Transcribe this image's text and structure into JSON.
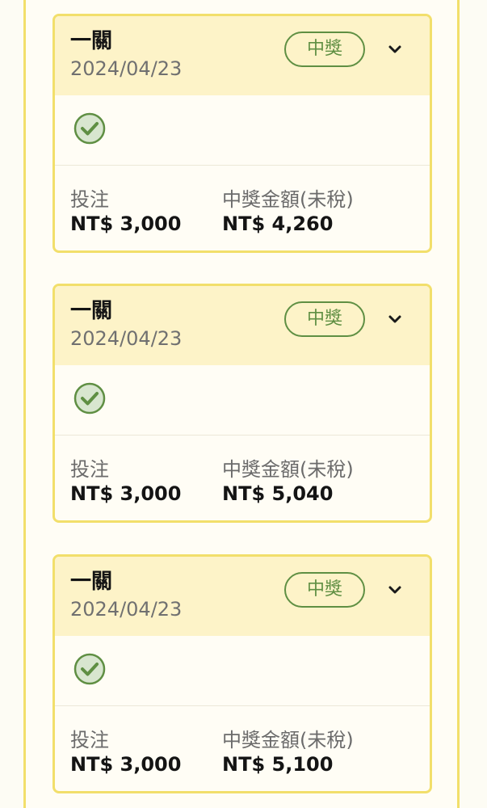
{
  "cards": [
    {
      "title": "一關",
      "date": "2024/04/23",
      "status": "中獎",
      "bet_label": "投注",
      "bet_value": "NT$ 3,000",
      "prize_label": "中獎金額(未稅)",
      "prize_value": "NT$ 4,260"
    },
    {
      "title": "一關",
      "date": "2024/04/23",
      "status": "中獎",
      "bet_label": "投注",
      "bet_value": "NT$ 3,000",
      "prize_label": "中獎金額(未稅)",
      "prize_value": "NT$ 5,040"
    },
    {
      "title": "一關",
      "date": "2024/04/23",
      "status": "中獎",
      "bet_label": "投注",
      "bet_value": "NT$ 3,000",
      "prize_label": "中獎金額(未稅)",
      "prize_value": "NT$ 5,100"
    }
  ],
  "icons": {
    "expand": "chevron-down-icon",
    "result": "check-circle-icon"
  },
  "colors": {
    "card_border": "#f2df6b",
    "header_bg": "#fdf3c8",
    "win_green": "#5f8f43",
    "check_fill": "#d8e6cf"
  }
}
